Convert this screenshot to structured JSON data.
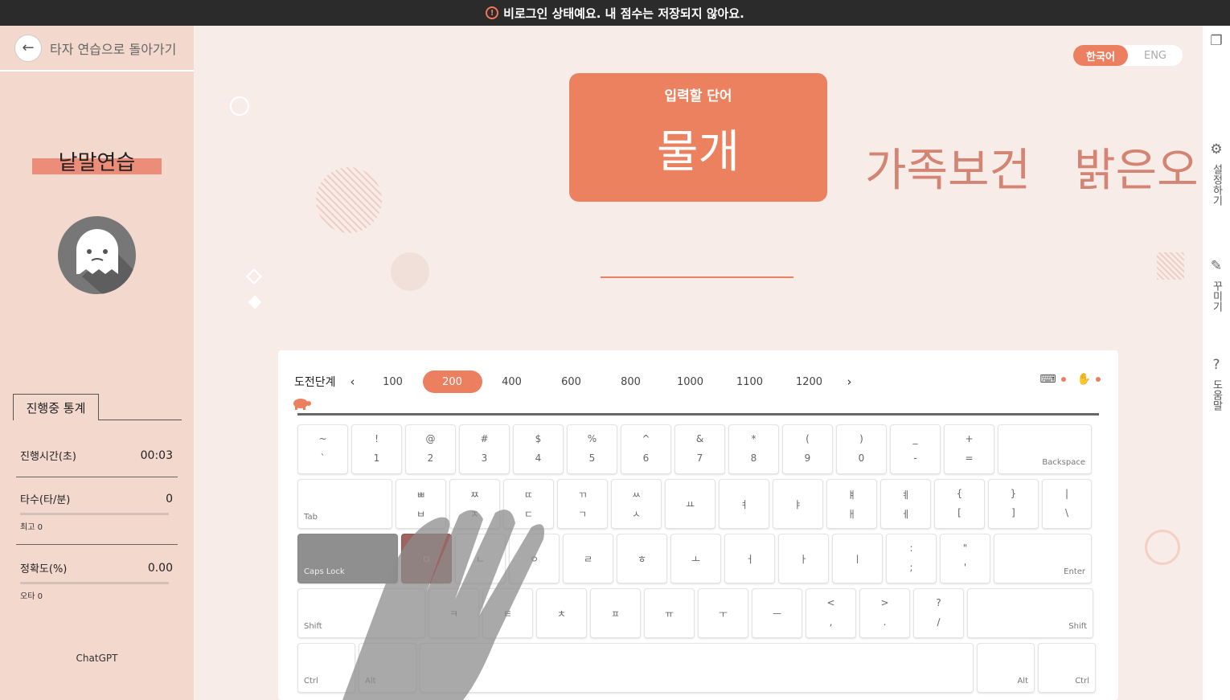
{
  "banner": {
    "text": "비로그인 상태예요. 내 점수는 저장되지 않아요.",
    "icon": "warning-icon"
  },
  "sidebar": {
    "back_label": "타자 연습으로 돌아가기",
    "mode_title": "낱말연습",
    "stats_tab": "진행중 통계",
    "stats": [
      {
        "label": "진행시간(초)",
        "value": "00:03"
      },
      {
        "label": "타수(타/분)",
        "value": "0",
        "sub": "최고 0"
      },
      {
        "label": "정확도(%)",
        "value": "0.00",
        "sub": "오타 0"
      }
    ],
    "footer": "ChatGPT"
  },
  "lang": {
    "korean": "한국어",
    "english": "ENG",
    "active": "korean"
  },
  "word_card": {
    "label": "입력할 단어",
    "word": "물개"
  },
  "next_words": [
    "가족보건",
    "밝은오"
  ],
  "levels": {
    "title": "도전단계",
    "items": [
      "100",
      "200",
      "400",
      "600",
      "800",
      "1000",
      "1100",
      "1200"
    ],
    "active": "200"
  },
  "keyboard": {
    "row1": [
      [
        "~",
        "`"
      ],
      [
        "!",
        "1"
      ],
      [
        "@",
        "2"
      ],
      [
        "#",
        "3"
      ],
      [
        "$",
        "4"
      ],
      [
        "%",
        "5"
      ],
      [
        "^",
        "6"
      ],
      [
        "&",
        "7"
      ],
      [
        "*",
        "8"
      ],
      [
        "(",
        "9"
      ],
      [
        ")",
        "0"
      ],
      [
        "_",
        "-"
      ],
      [
        "+",
        "="
      ]
    ],
    "backspace": "Backspace",
    "tab": "Tab",
    "row2": [
      [
        "ㅃ",
        "ㅂ"
      ],
      [
        "ㅉ",
        "ㅈ"
      ],
      [
        "ㄸ",
        "ㄷ"
      ],
      [
        "ㄲ",
        "ㄱ"
      ],
      [
        "ㅆ",
        "ㅅ"
      ],
      [
        "",
        "ㅛ"
      ],
      [
        "",
        "ㅕ"
      ],
      [
        "",
        "ㅑ"
      ],
      [
        "ㅒ",
        "ㅐ"
      ],
      [
        "ㅖ",
        "ㅔ"
      ],
      [
        "{",
        "["
      ],
      [
        "}",
        "]"
      ],
      [
        "|",
        "\\"
      ]
    ],
    "caps": "Caps Lock",
    "row3": [
      "ㅁ",
      "ㄴ",
      "ㅇ",
      "ㄹ",
      "ㅎ",
      "ㅗ",
      "ㅓ",
      "ㅏ",
      "ㅣ"
    ],
    "row3_sym": [
      [
        ":",
        ";"
      ],
      [
        "\"",
        "'"
      ]
    ],
    "enter": "Enter",
    "shift": "Shift",
    "row4": [
      "ㅋ",
      "ㅌ",
      "ㅊ",
      "ㅍ",
      "ㅠ",
      "ㅜ",
      "ㅡ"
    ],
    "row4_sym": [
      [
        "<",
        ","
      ],
      [
        ">",
        "."
      ],
      [
        "?",
        "/"
      ]
    ],
    "ctrl": "Ctrl",
    "alt": "Alt"
  },
  "rightbar": {
    "settings": "설정하기",
    "decorate": "꾸미기",
    "help": "도움말"
  }
}
